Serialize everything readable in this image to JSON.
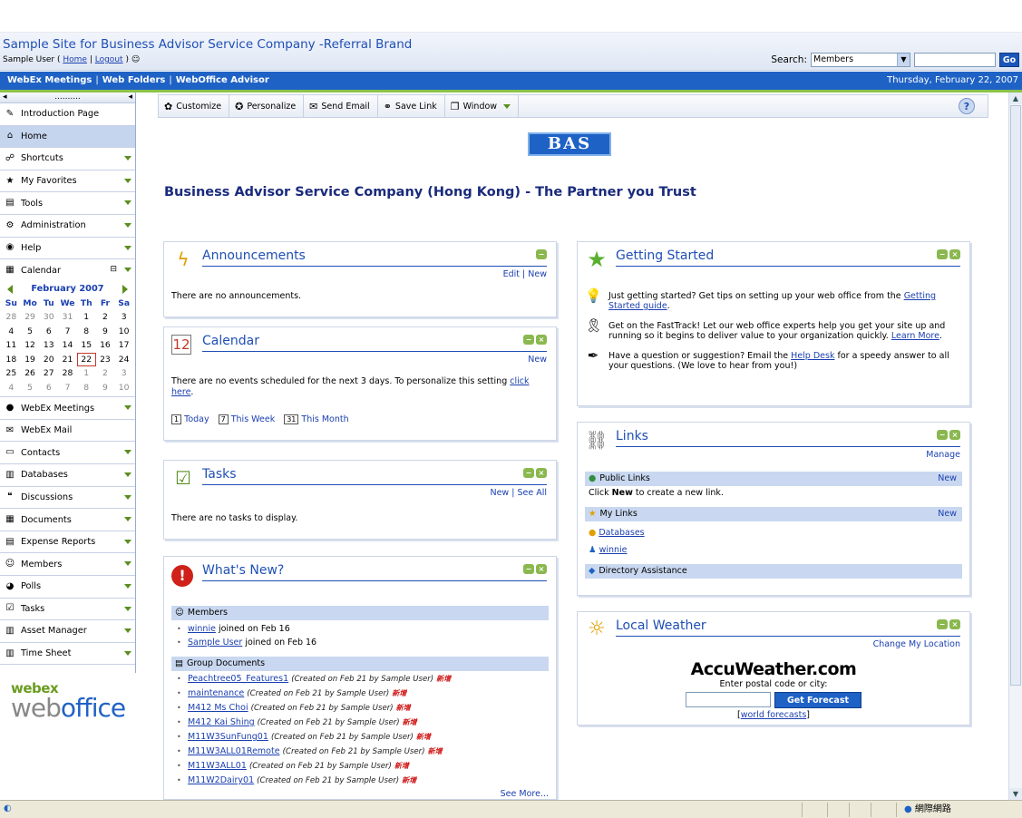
{
  "site": {
    "title": "Sample Site for Business Advisor Service Company -Referral Brand",
    "user_prefix": "Sample User (",
    "home_link": "Home",
    "logout_link": "Logout",
    "user_suffix": ")",
    "search_label": "Search:",
    "search_scope": "Members",
    "search_value": "",
    "go_label": "Go"
  },
  "nav": {
    "items": [
      "WebEx Meetings",
      "Web Folders",
      "WebOffice Advisor"
    ],
    "date": "Thursday, February 22, 2007"
  },
  "sidebar": {
    "top_dots": "..........",
    "items_top": [
      {
        "label": "Introduction Page",
        "icon": "pencil-icon",
        "glyph": "✎",
        "dropdown": false
      },
      {
        "label": "Home",
        "icon": "home-icon",
        "glyph": "⌂",
        "dropdown": false,
        "active": true
      },
      {
        "label": "Shortcuts",
        "icon": "shortcuts-icon",
        "glyph": "☍",
        "dropdown": true
      },
      {
        "label": "My Favorites",
        "icon": "star-icon",
        "glyph": "★",
        "dropdown": true
      },
      {
        "label": "Tools",
        "icon": "tools-icon",
        "glyph": "▤",
        "dropdown": true
      },
      {
        "label": "Administration",
        "icon": "gears-icon",
        "glyph": "⚙",
        "dropdown": true
      },
      {
        "label": "Help",
        "icon": "help-icon",
        "glyph": "◉",
        "dropdown": true
      }
    ],
    "calendar": {
      "label": "Calendar",
      "month": "February 2007",
      "days": [
        "Su",
        "Mo",
        "Tu",
        "We",
        "Th",
        "Fr",
        "Sa"
      ],
      "weeks": [
        [
          [
            "28",
            1
          ],
          [
            "29",
            1
          ],
          [
            "30",
            1
          ],
          [
            "31",
            1
          ],
          [
            "1",
            0
          ],
          [
            "2",
            0
          ],
          [
            "3",
            0
          ]
        ],
        [
          [
            "4",
            0
          ],
          [
            "5",
            0
          ],
          [
            "6",
            0
          ],
          [
            "7",
            0
          ],
          [
            "8",
            0
          ],
          [
            "9",
            0
          ],
          [
            "10",
            0
          ]
        ],
        [
          [
            "11",
            0
          ],
          [
            "12",
            0
          ],
          [
            "13",
            0
          ],
          [
            "14",
            0
          ],
          [
            "15",
            0
          ],
          [
            "16",
            0
          ],
          [
            "17",
            0
          ]
        ],
        [
          [
            "18",
            0
          ],
          [
            "19",
            0
          ],
          [
            "20",
            0
          ],
          [
            "21",
            0
          ],
          [
            "22",
            2
          ],
          [
            "23",
            0
          ],
          [
            "24",
            0
          ]
        ],
        [
          [
            "25",
            0
          ],
          [
            "26",
            0
          ],
          [
            "27",
            0
          ],
          [
            "28",
            0
          ],
          [
            "1",
            1
          ],
          [
            "2",
            1
          ],
          [
            "3",
            1
          ]
        ],
        [
          [
            "4",
            1
          ],
          [
            "5",
            1
          ],
          [
            "6",
            1
          ],
          [
            "7",
            1
          ],
          [
            "8",
            1
          ],
          [
            "9",
            1
          ],
          [
            "10",
            1
          ]
        ]
      ]
    },
    "items_bottom": [
      {
        "label": "WebEx Meetings",
        "icon": "globe-icon",
        "glyph": "●",
        "dropdown": true
      },
      {
        "label": "WebEx Mail",
        "icon": "mail-icon",
        "glyph": "✉",
        "dropdown": false
      },
      {
        "label": "Contacts",
        "icon": "contacts-icon",
        "glyph": "▭",
        "dropdown": true
      },
      {
        "label": "Databases",
        "icon": "database-icon",
        "glyph": "▥",
        "dropdown": true
      },
      {
        "label": "Discussions",
        "icon": "discussion-icon",
        "glyph": "❝",
        "dropdown": true
      },
      {
        "label": "Documents",
        "icon": "documents-icon",
        "glyph": "▦",
        "dropdown": true
      },
      {
        "label": "Expense Reports",
        "icon": "expense-icon",
        "glyph": "▤",
        "dropdown": true
      },
      {
        "label": "Members",
        "icon": "members-icon",
        "glyph": "☺",
        "dropdown": true
      },
      {
        "label": "Polls",
        "icon": "polls-icon",
        "glyph": "◕",
        "dropdown": true
      },
      {
        "label": "Tasks",
        "icon": "tasks-icon",
        "glyph": "☑",
        "dropdown": true
      },
      {
        "label": "Asset Manager",
        "icon": "asset-icon",
        "glyph": "▥",
        "dropdown": true
      },
      {
        "label": "Time Sheet",
        "icon": "timesheet-icon",
        "glyph": "▥",
        "dropdown": true
      }
    ],
    "logo_top": "webex",
    "logo_bottom_a": "web",
    "logo_bottom_b": "office"
  },
  "toolbar": {
    "buttons": [
      {
        "label": "Customize",
        "glyph": "✿"
      },
      {
        "label": "Personalize",
        "glyph": "✪"
      },
      {
        "label": "Send Email",
        "glyph": "✉"
      },
      {
        "label": "Save Link",
        "glyph": "⚭"
      },
      {
        "label": "Window",
        "glyph": "❐"
      }
    ],
    "help_glyph": "?"
  },
  "banner": {
    "logo_text": "BAS",
    "tagline": "Business Advisor Service Company (Hong Kong) - The Partner you Trust"
  },
  "announcements": {
    "title": "Announcements",
    "edit": "Edit",
    "new": "New",
    "empty": "There are no announcements."
  },
  "calendar_panel": {
    "title": "Calendar",
    "new": "New",
    "text": "There are no events scheduled for the next 3 days. To personalize this setting ",
    "link": "click here",
    "after": ".",
    "today": "Today",
    "week": "This Week",
    "month": "This Month",
    "today_num": "1",
    "week_num": "7",
    "month_num": "31"
  },
  "tasks": {
    "title": "Tasks",
    "new": "New",
    "see_all": "See All",
    "empty": "There are no tasks to display."
  },
  "whats_new": {
    "title": "What's New?",
    "members_head": "Members",
    "members": [
      {
        "name": "winnie",
        "text": " joined on Feb 16"
      },
      {
        "name": "Sample User",
        "text": " joined on Feb 16"
      }
    ],
    "docs_head": "Group Documents",
    "docs": [
      {
        "name": "Peachtree05_Features1",
        "meta": "(Created on Feb 21 by Sample User)"
      },
      {
        "name": "maintenance",
        "meta": "(Created on Feb 21 by Sample User)"
      },
      {
        "name": "M412 Ms Choi",
        "meta": "(Created on Feb 21 by Sample User)"
      },
      {
        "name": "M412 Kai Shing",
        "meta": "(Created on Feb 21 by Sample User)"
      },
      {
        "name": "M11W3SunFung01",
        "meta": "(Created on Feb 21 by Sample User)"
      },
      {
        "name": "M11W3ALL01Remote",
        "meta": "(Created on Feb 21 by Sample User)"
      },
      {
        "name": "M11W3ALL01",
        "meta": "(Created on Feb 21 by Sample User)"
      },
      {
        "name": "M11W2Dairy01",
        "meta": "(Created on Feb 21 by Sample User)"
      }
    ],
    "new_tag": "新增",
    "see_more": "See More..."
  },
  "getting_started": {
    "title": "Getting Started",
    "items": [
      {
        "glyph": "💡",
        "icon": "lightbulb-icon",
        "text": "Just getting started? Get tips on setting up your web office from the ",
        "link": "Getting Started guide",
        "after": "."
      },
      {
        "glyph": "🎗",
        "icon": "ribbon-icon",
        "text": "Get on the FastTrack! Let our web office experts help you get your site up and running so it begins to deliver value to your organization quickly. ",
        "link": "Learn More",
        "after": "."
      },
      {
        "glyph": "✒",
        "icon": "pen-icon",
        "text": "Have a question or suggestion? Email the ",
        "link": "Help Desk",
        "after": " for a speedy answer to all your questions. (We love to hear from you!)"
      }
    ]
  },
  "links": {
    "title": "Links",
    "manage": "Manage",
    "public_head": "Public Links",
    "public_new": "New",
    "public_text_a": "Click ",
    "public_text_b": "New",
    "public_text_c": " to create a new link.",
    "my_head": "My Links",
    "my_new": "New",
    "my_items": [
      "Databases",
      "winnie"
    ],
    "dir": "Directory Assistance"
  },
  "weather": {
    "title": "Local Weather",
    "change": "Change My Location",
    "brand": "AccuWeather.com",
    "prompt": "Enter postal code or city:",
    "button": "Get Forecast",
    "world_a": "[",
    "world": "world forecasts",
    "world_b": "]"
  },
  "status": {
    "zone": "網際網路"
  }
}
